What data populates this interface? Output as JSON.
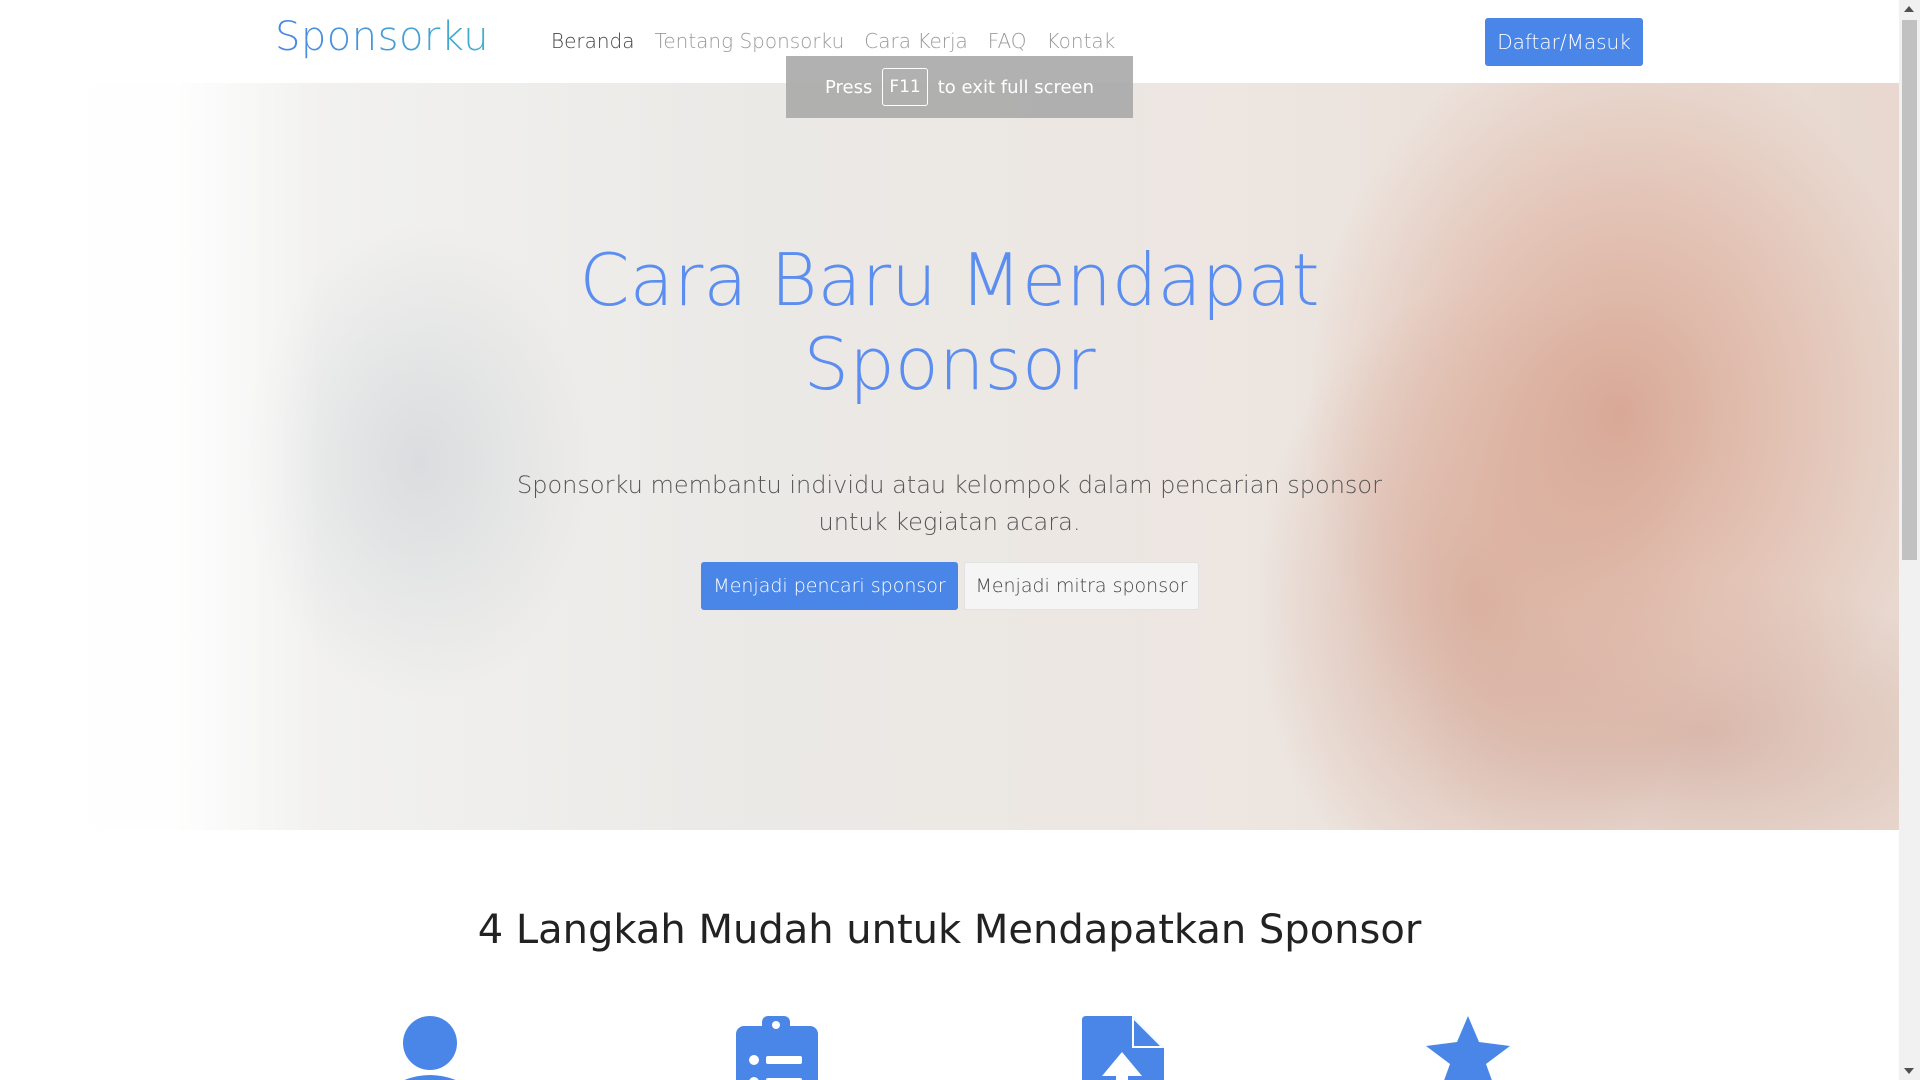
{
  "navbar": {
    "brand": "Sponsorku",
    "links": [
      {
        "label": "Beranda",
        "active": true
      },
      {
        "label": "Tentang Sponsorku",
        "active": false
      },
      {
        "label": "Cara Kerja",
        "active": false
      },
      {
        "label": "FAQ",
        "active": false
      },
      {
        "label": "Kontak",
        "active": false
      }
    ],
    "cta_label": "Daftar/Masuk"
  },
  "fullscreen_notice": {
    "before": "Press",
    "key": "F11",
    "after": "to exit full screen"
  },
  "hero": {
    "title_line1": "Cara Baru Mendapat",
    "title_line2": "Sponsor",
    "subtitle_line1": "Sponsorku membantu individu atau kelompok dalam pencarian sponsor",
    "subtitle_line2": "untuk kegiatan acara.",
    "primary_button": "Menjadi pencari sponsor",
    "secondary_button": "Menjadi mitra sponsor"
  },
  "steps": {
    "title": "4 Langkah Mudah untuk Mendapatkan Sponsor",
    "icons": [
      "user-icon",
      "clipboard-list-icon",
      "document-upload-icon",
      "star-icon"
    ]
  },
  "colors": {
    "accent": "#4a86e8",
    "title": "#5b8ef0"
  }
}
